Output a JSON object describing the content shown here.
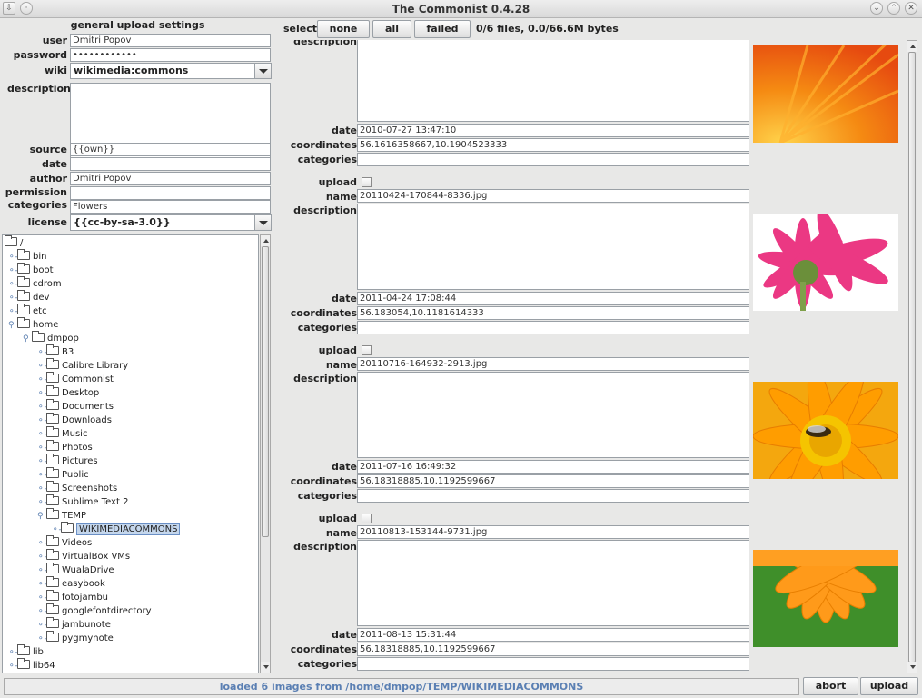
{
  "window": {
    "title": "The Commonist 0.4.28"
  },
  "settings": {
    "header": "general upload settings",
    "user_label": "user",
    "user_value": "Dmitri Popov",
    "password_label": "password",
    "password_value": "••••••••••••",
    "wiki_label": "wiki",
    "wiki_value": "wikimedia:commons",
    "description_label": "description",
    "source_label": "source",
    "source_value": "{{own}}",
    "date_label": "date",
    "date_value": "",
    "author_label": "author",
    "author_value": "Dmitri Popov",
    "permission_label": "permission",
    "permission_value": "",
    "categories_label": "categories",
    "categories_value": "Flowers",
    "license_label": "license",
    "license_value": "{{cc-by-sa-3.0}}"
  },
  "tree": {
    "items": [
      {
        "label": "/",
        "expanded": true
      },
      {
        "label": "bin"
      },
      {
        "label": "boot"
      },
      {
        "label": "cdrom"
      },
      {
        "label": "dev"
      },
      {
        "label": "etc"
      },
      {
        "label": "home",
        "expanded": true
      },
      {
        "label": "dmpop",
        "expanded": true
      },
      {
        "label": "B3"
      },
      {
        "label": "Calibre Library"
      },
      {
        "label": "Commonist"
      },
      {
        "label": "Desktop"
      },
      {
        "label": "Documents"
      },
      {
        "label": "Downloads"
      },
      {
        "label": "Music"
      },
      {
        "label": "Photos"
      },
      {
        "label": "Pictures"
      },
      {
        "label": "Public"
      },
      {
        "label": "Screenshots"
      },
      {
        "label": "Sublime Text 2"
      },
      {
        "label": "TEMP",
        "expanded": true
      },
      {
        "label": "WIKIMEDIACOMMONS",
        "selected": true
      },
      {
        "label": "Videos"
      },
      {
        "label": "VirtualBox VMs"
      },
      {
        "label": "WualaDrive"
      },
      {
        "label": "easybook"
      },
      {
        "label": "fotojambu"
      },
      {
        "label": "googlefontdirectory"
      },
      {
        "label": "jambunote"
      },
      {
        "label": "pygmynote"
      },
      {
        "label": "lib"
      },
      {
        "label": "lib64"
      }
    ]
  },
  "selection": {
    "label": "select",
    "none_button": "none",
    "all_button": "all",
    "failed_button": "failed",
    "info": "0/6 files, 0.0/66.6M bytes"
  },
  "labels": {
    "upload": "upload",
    "name": "name",
    "description": "description",
    "date": "date",
    "coordinates": "coordinates",
    "categories": "categories"
  },
  "images": [
    {
      "date": "2010-07-27 13:47:10",
      "coordinates": "56.1616358667,10.1904523333",
      "categories": ""
    },
    {
      "name": "20110424-170844-8336.jpg",
      "date": "2011-04-24 17:08:44",
      "coordinates": "56.183054,10.1181614333",
      "categories": ""
    },
    {
      "name": "20110716-164932-2913.jpg",
      "date": "2011-07-16 16:49:32",
      "coordinates": "56.18318885,10.1192599667",
      "categories": ""
    },
    {
      "name": "20110813-153144-9731.jpg",
      "date": "2011-08-13 15:31:44",
      "coordinates": "56.18318885,10.1192599667",
      "categories": ""
    }
  ],
  "status": {
    "message": "loaded 6 images from /home/dmpop/TEMP/WIKIMEDIACOMMONS",
    "abort_button": "abort",
    "upload_button": "upload"
  }
}
